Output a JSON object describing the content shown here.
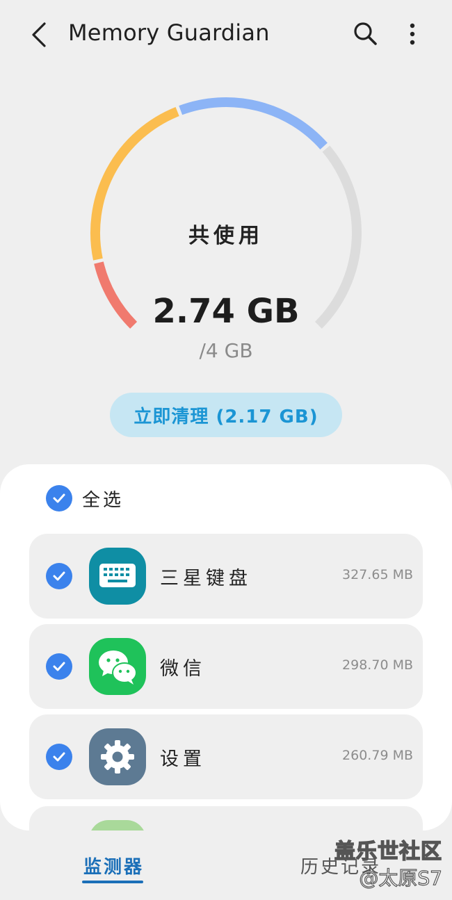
{
  "header": {
    "title": "Memory Guardian",
    "back_icon": "back-arrow-icon",
    "search_icon": "search-icon",
    "more_icon": "more-vertical-icon"
  },
  "memory": {
    "used_label": "共使用",
    "used_value": "2.74 GB",
    "total_value": "/4 GB",
    "used_gb": 2.74,
    "total_gb": 4,
    "ring_colors": [
      "#f07a6e",
      "#fbbd4f",
      "#8cb4f6",
      "#dcdcdc"
    ]
  },
  "clean_button": {
    "label": "立即清理 (2.17 GB)"
  },
  "select_all": {
    "label": "全选",
    "checked": true
  },
  "apps": [
    {
      "name": "三星键盘",
      "size": "327.65 MB",
      "icon": "keyboard-icon",
      "color": "#0f8ea4",
      "checked": true
    },
    {
      "name": "微信",
      "size": "298.70 MB",
      "icon": "wechat-icon",
      "color": "#1fc25a",
      "checked": true
    },
    {
      "name": "设置",
      "size": "260.79 MB",
      "icon": "settings-gear-icon",
      "color": "#5d7a93",
      "checked": true
    }
  ],
  "tabs": {
    "monitor": "监测器",
    "history": "历史记录"
  },
  "watermark": {
    "line1": "盖乐世社区",
    "line2": "@太原S7"
  }
}
